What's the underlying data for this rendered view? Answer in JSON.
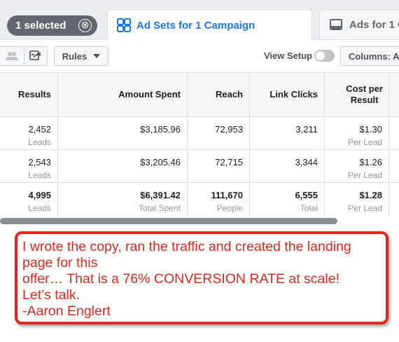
{
  "tabbar": {
    "selected_label": "1 selected",
    "clear_symbol": "⊗",
    "active_tab_label": "Ad Sets for 1 Campaign",
    "next_tab_label": "Ads for 1 C",
    "accent_color": "#1877f2"
  },
  "toolbar": {
    "rules_label": "Rules",
    "view_setup_label": "View Setup",
    "view_setup_on": false,
    "columns_label": "Columns: A"
  },
  "table": {
    "headers": {
      "results": "Results",
      "amount_spent": "Amount Spent",
      "reach": "Reach",
      "link_clicks": "Link Clicks",
      "cost_per_result_1": "Cost per",
      "cost_per_result_2": "Result"
    },
    "rows": [
      {
        "results": "2,452",
        "results_sub": "Leads",
        "amount_spent": "$3,185.96",
        "reach": "72,953",
        "link_clicks": "3,211",
        "cost": "$1.30",
        "cost_sub": "Per Lead"
      },
      {
        "results": "2,543",
        "results_sub": "Leads",
        "amount_spent": "$3,205.46",
        "reach": "72,715",
        "link_clicks": "3,344",
        "cost": "$1.26",
        "cost_sub": "Per Lead"
      }
    ],
    "total": {
      "results": "4,995",
      "results_sub": "Leads",
      "amount_spent": "$6,391.42",
      "amount_spent_sub": "Total Spent",
      "reach": "111,670",
      "reach_sub": "People",
      "link_clicks": "6,555",
      "link_clicks_sub": "Total",
      "cost": "$1.28",
      "cost_sub": "Per Lead"
    }
  },
  "annotation": {
    "line1": "I wrote the copy, ran the traffic and created the landing",
    "line2": "page for this",
    "line3": "offer… That is a 76% CONVERSION RATE at scale!",
    "line4": "Let’s talk.",
    "line5": "-Aaron Englert",
    "color": "#e0261d"
  }
}
